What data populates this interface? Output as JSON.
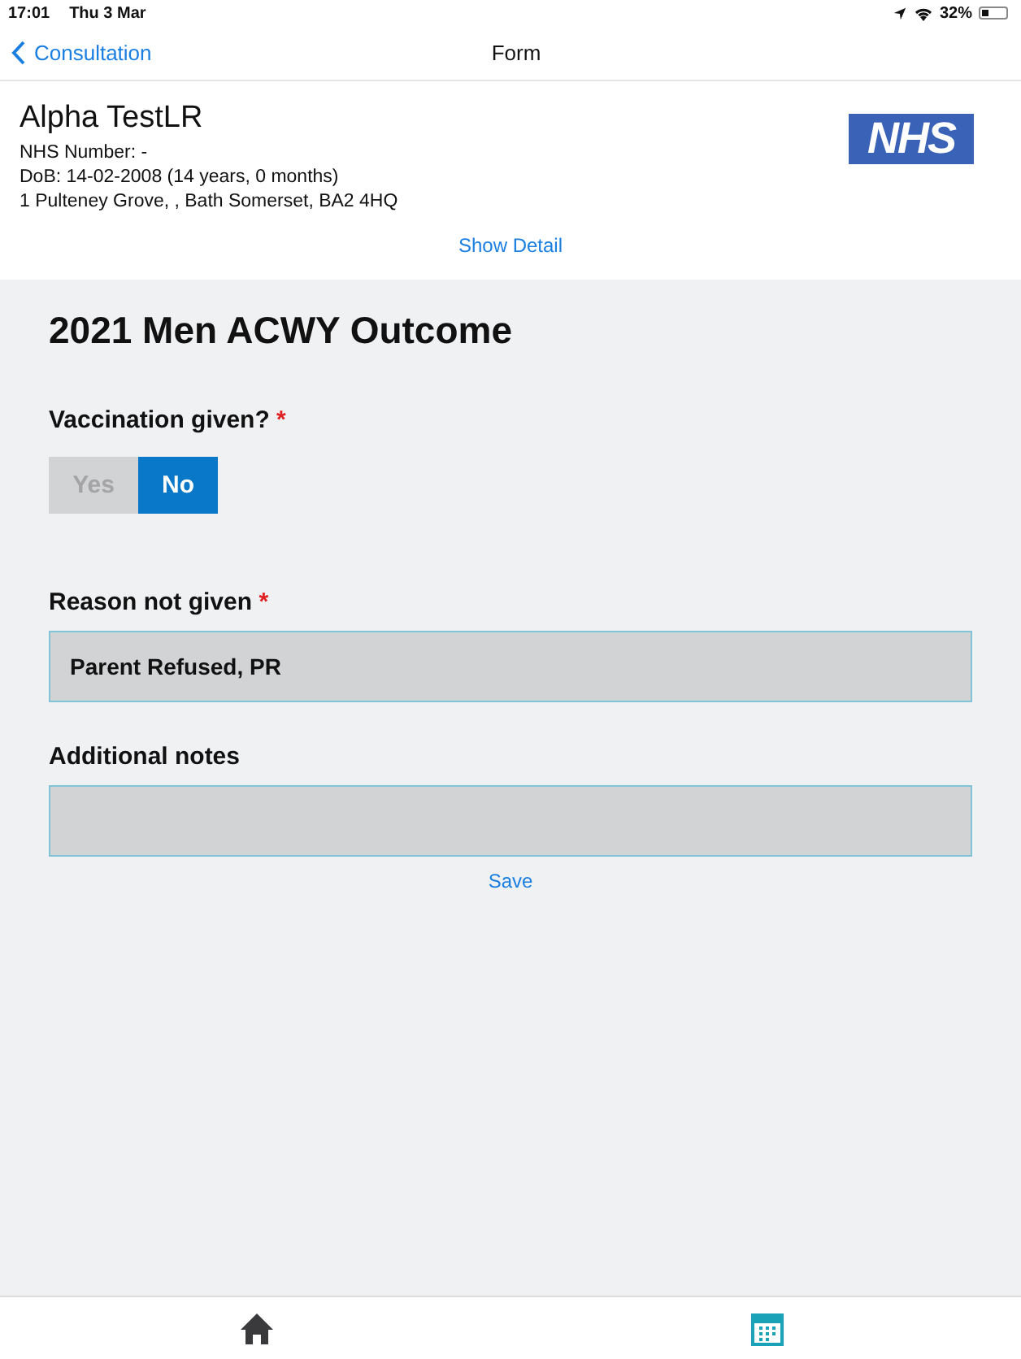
{
  "status_bar": {
    "time": "17:01",
    "date": "Thu 3 Mar",
    "battery_text": "32%"
  },
  "nav": {
    "back": "Consultation",
    "title": "Form"
  },
  "patient": {
    "name": "Alpha TestLR",
    "nhs_number": "NHS Number:  -",
    "dob": "DoB: 14-02-2008 (14 years, 0 months)",
    "address": "1 Pulteney Grove,  , Bath Somerset, BA2 4HQ",
    "logo": "NHS",
    "show_detail": "Show Detail"
  },
  "form": {
    "title": "2021 Men ACWY Outcome",
    "vaccination": {
      "label": "Vaccination given?",
      "required_mark": "*",
      "options": [
        {
          "label": "Yes",
          "selected": false
        },
        {
          "label": "No",
          "selected": true
        }
      ]
    },
    "reason": {
      "label": "Reason not given",
      "required_mark": "*",
      "value": "Parent Refused, PR"
    },
    "notes": {
      "label": "Additional notes"
    },
    "save": "Save"
  },
  "tabs": [
    {
      "kind": "home",
      "selected": false
    },
    {
      "kind": "calendar",
      "selected": true
    }
  ]
}
